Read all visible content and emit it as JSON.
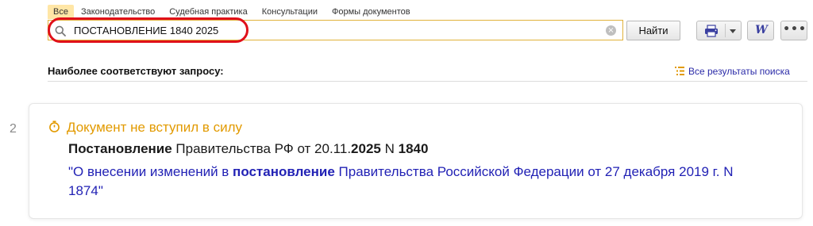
{
  "tabs": [
    "Все",
    "Законодательство",
    "Судебная практика",
    "Консультации",
    "Формы документов"
  ],
  "search": {
    "value": "ПОСТАНОВЛЕНИЕ 1840 2025",
    "clear_icon": "×"
  },
  "buttons": {
    "find": "Найти"
  },
  "icons": {
    "search": "search-icon",
    "print": "printer-icon",
    "word": "W",
    "more": "•••"
  },
  "section": {
    "title": "Наиболее соответствуют запросу:",
    "all_results": "Все результаты поиска"
  },
  "result": {
    "number": "2",
    "status": "Документ не вступил в силу",
    "title": {
      "p1": "Постановление",
      "p2": " Правительства РФ от 20.11.",
      "p3": "2025",
      "p4": " N ",
      "p5": "1840"
    },
    "subtitle": {
      "s1": "\"О внесении изменений в ",
      "s2": "постановление",
      "s3": " Правительства Российской Федерации от 27 декабря 2019 г. N 1874\""
    }
  },
  "colors": {
    "accent": "#e1b23a",
    "highlight_ring": "#e0101a",
    "status": "#e29a00",
    "link": "#2222b5",
    "active_tab": "#ffe6a6"
  }
}
